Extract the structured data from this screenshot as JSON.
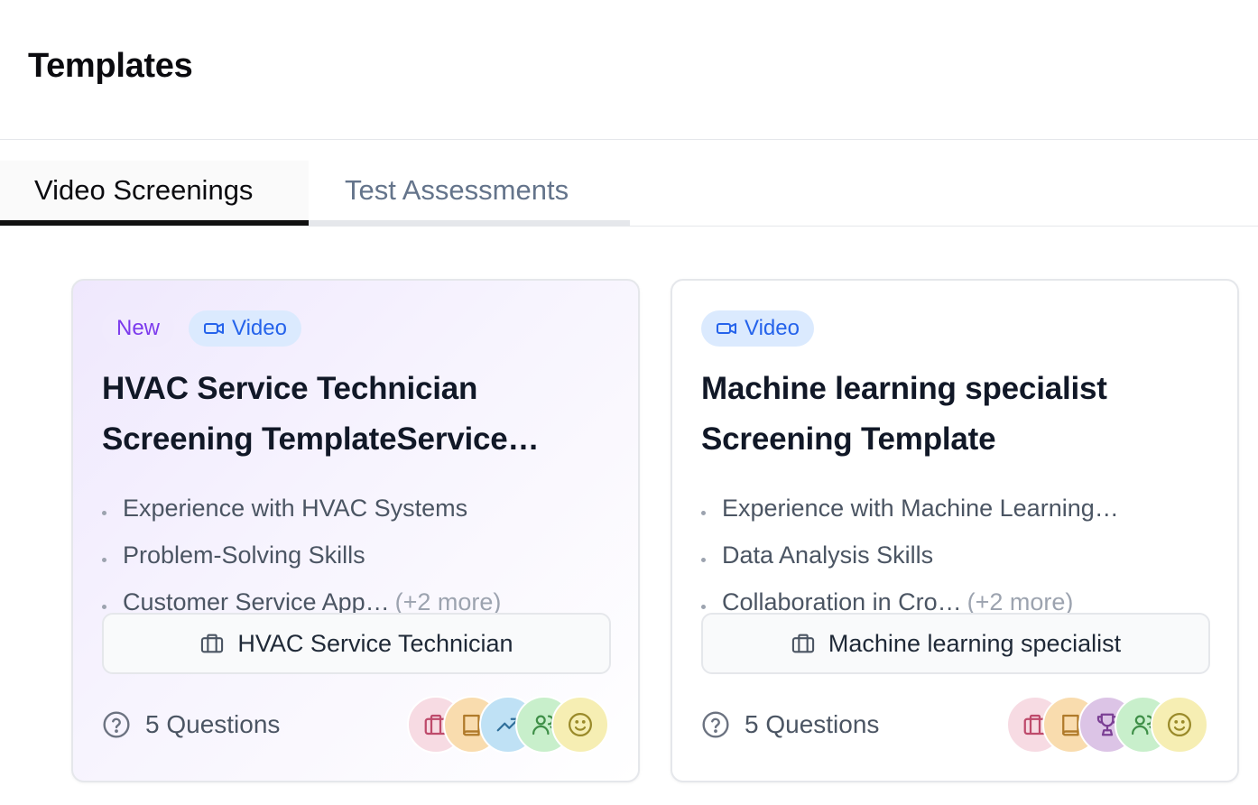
{
  "header": {
    "title": "Templates"
  },
  "tabs": [
    {
      "label": "Video Screenings",
      "active": true
    },
    {
      "label": "Test Assessments",
      "active": false
    }
  ],
  "cards": [
    {
      "badge_new": "New",
      "badge_video": "Video",
      "title": "HVAC Service Technician Screening TemplateService…",
      "skills": [
        "Experience with HVAC Systems",
        "Problem-Solving Skills",
        "Customer Service App…"
      ],
      "more": "(+2 more)",
      "role": "HVAC Service Technician",
      "questions": "5 Questions",
      "avatar_icons": [
        "briefcase-icon",
        "book-icon",
        "trend-icon",
        "users-icon",
        "smile-icon"
      ]
    },
    {
      "badge_video": "Video",
      "title": "Machine learning specialist Screening Template",
      "skills": [
        "Experience with Machine Learning…",
        "Data Analysis Skills",
        "Collaboration in Cro…"
      ],
      "more": "(+2 more)",
      "role": "Machine learning specialist",
      "questions": "5 Questions",
      "avatar_icons": [
        "briefcase-icon",
        "book-icon",
        "trophy-icon",
        "users-icon",
        "smile-icon"
      ]
    }
  ],
  "colors": {
    "new_badge_text": "#7c3aed",
    "video_badge_text": "#2563eb",
    "avatar_pink": "#f7dbe3",
    "avatar_orange": "#f9dcae",
    "avatar_blue": "#bfe1f5",
    "avatar_purple": "#dcc4e6",
    "avatar_green": "#c8efcb",
    "avatar_yellow": "#f6eeb3"
  }
}
